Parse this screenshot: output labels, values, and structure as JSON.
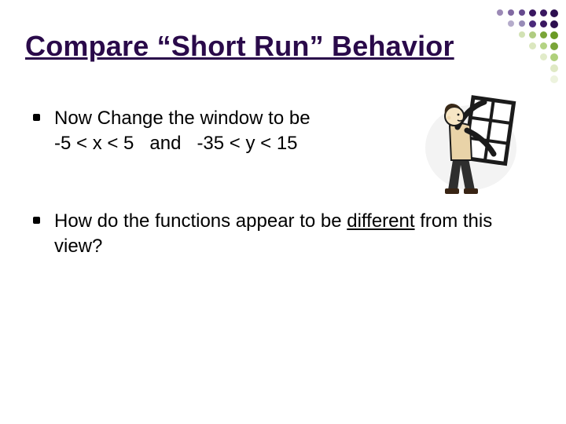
{
  "title": "Compare “Short Run” Behavior",
  "bullets": [
    {
      "line1": "Now Change the window to be",
      "line2": "-5 < x < 5   and   -35 < y < 15"
    },
    {
      "pre": "How do the functions appear to be ",
      "underline": "different",
      "post": " from this view?"
    }
  ]
}
